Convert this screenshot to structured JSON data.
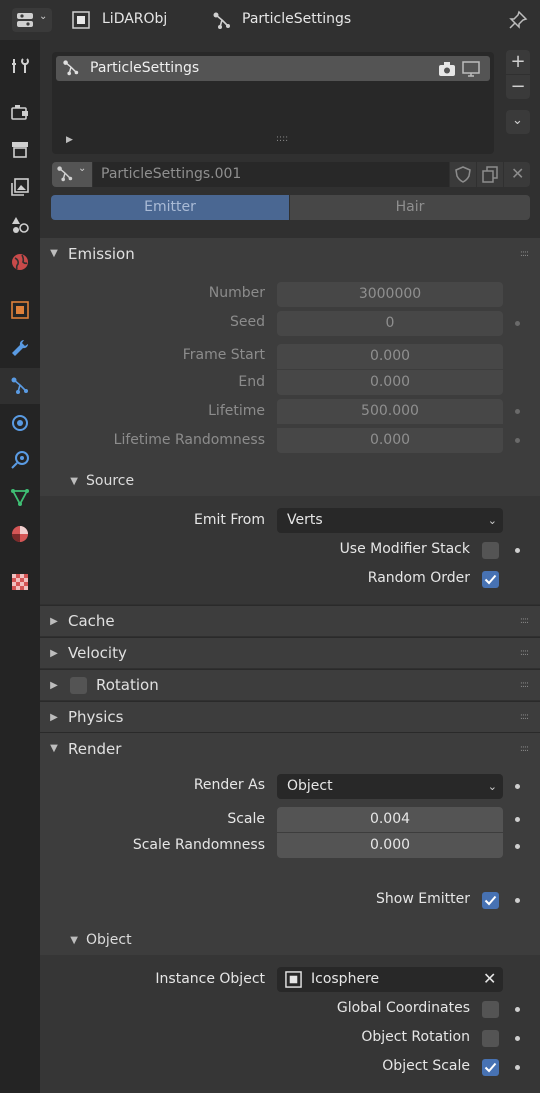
{
  "header": {
    "editor_type_icon": "properties-editor-icon",
    "object_name": "LiDARObj",
    "particle_settings_name": "ParticleSettings"
  },
  "tabs": [
    {
      "name": "tool-tab",
      "icon": "wrench-screwdriver-icon"
    },
    {
      "name": "render-tab",
      "icon": "camera-back-icon"
    },
    {
      "name": "output-tab",
      "icon": "printer-icon"
    },
    {
      "name": "view-layer-tab",
      "icon": "image-stack-icon"
    },
    {
      "name": "scene-tab",
      "icon": "scene-shapes-icon"
    },
    {
      "name": "world-tab",
      "icon": "globe-icon"
    },
    {
      "name": "object-tab",
      "icon": "object-square-icon"
    },
    {
      "name": "modifiers-tab",
      "icon": "wrench-icon"
    },
    {
      "name": "particles-tab",
      "icon": "particles-icon"
    },
    {
      "name": "physics-tab",
      "icon": "physics-orbit-icon"
    },
    {
      "name": "constraints-tab",
      "icon": "constraint-icon"
    },
    {
      "name": "data-tab",
      "icon": "mesh-triangle-icon"
    },
    {
      "name": "material-tab",
      "icon": "material-sphere-icon"
    },
    {
      "name": "texture-tab",
      "icon": "checker-icon"
    }
  ],
  "particle_list": {
    "items": [
      {
        "label": "ParticleSettings"
      }
    ],
    "add_label": "+",
    "remove_label": "−",
    "grip_label": "::::"
  },
  "datablock": {
    "name": "ParticleSettings.001"
  },
  "type_toggle": {
    "emitter_label": "Emitter",
    "hair_label": "Hair",
    "selected": "Emitter"
  },
  "emission": {
    "title": "Emission",
    "number_label": "Number",
    "number_value": "3000000",
    "seed_label": "Seed",
    "seed_value": "0",
    "frame_start_label": "Frame Start",
    "frame_start_value": "0.000",
    "end_label": "End",
    "end_value": "0.000",
    "lifetime_label": "Lifetime",
    "lifetime_value": "500.000",
    "lifetime_rand_label": "Lifetime Randomness",
    "lifetime_rand_value": "0.000"
  },
  "source": {
    "title": "Source",
    "emit_from_label": "Emit From",
    "emit_from_value": "Verts",
    "use_modifier_stack_label": "Use Modifier Stack",
    "use_modifier_stack": false,
    "random_order_label": "Random Order",
    "random_order": true
  },
  "collapsed_panels": {
    "cache": "Cache",
    "velocity": "Velocity",
    "rotation": "Rotation",
    "physics": "Physics"
  },
  "render": {
    "title": "Render",
    "render_as_label": "Render As",
    "render_as_value": "Object",
    "scale_label": "Scale",
    "scale_value": "0.004",
    "scale_rand_label": "Scale Randomness",
    "scale_rand_value": "0.000",
    "show_emitter_label": "Show Emitter",
    "show_emitter": true
  },
  "object": {
    "title": "Object",
    "instance_object_label": "Instance Object",
    "instance_object_value": "Icosphere",
    "global_coords_label": "Global Coordinates",
    "global_coords": false,
    "object_rotation_label": "Object Rotation",
    "object_rotation": false,
    "object_scale_label": "Object Scale",
    "object_scale": true
  },
  "colors": {
    "accent": "#4772b3",
    "background": "#303030",
    "panel": "#3d3d3d",
    "tab_bar": "#242424"
  }
}
